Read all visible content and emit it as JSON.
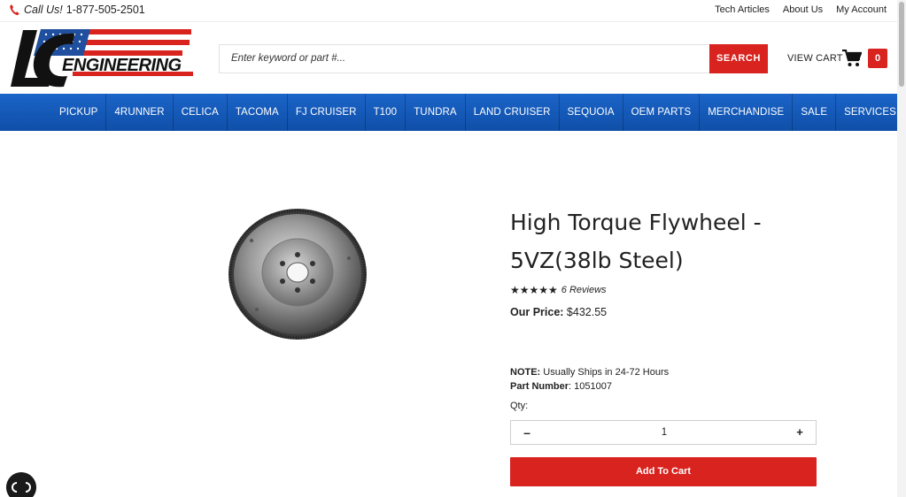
{
  "topbar": {
    "call_label": "Call Us!",
    "phone": "1-877-505-2501",
    "links": [
      "Tech Articles",
      "About Us",
      "My Account"
    ]
  },
  "header": {
    "logo_text": "LC ENGINEERING",
    "search_placeholder": "Enter keyword or part #...",
    "search_button": "SEARCH",
    "view_cart": "VIEW CART",
    "cart_count": "0"
  },
  "nav": {
    "items": [
      "PICKUP",
      "4RUNNER",
      "CELICA",
      "TACOMA",
      "FJ CRUISER",
      "T100",
      "TUNDRA",
      "LAND CRUISER",
      "SEQUOIA",
      "OEM PARTS",
      "MERCHANDISE",
      "SALE",
      "SERVICES"
    ]
  },
  "product": {
    "title_line1": "High Torque Flywheel -",
    "title_line2": "5VZ(38lb Steel)",
    "stars": "★★★★★",
    "rating": 5,
    "reviews": "6 Reviews",
    "price_label": "Our Price:",
    "price": "$432.55",
    "note_label": "NOTE:",
    "note_text": "Usually Ships in 24-72 Hours",
    "part_label": "Part Number",
    "part_number": "1051007",
    "qty_label": "Qty:",
    "qty_minus": "–",
    "qty_value": "1",
    "qty_plus": "+",
    "add_to_cart": "Add To Cart"
  },
  "colors": {
    "accent_red": "#d8231f",
    "nav_blue": "#1b64c8"
  },
  "icons": [
    "phone-icon",
    "cart-icon",
    "chat-icon"
  ]
}
